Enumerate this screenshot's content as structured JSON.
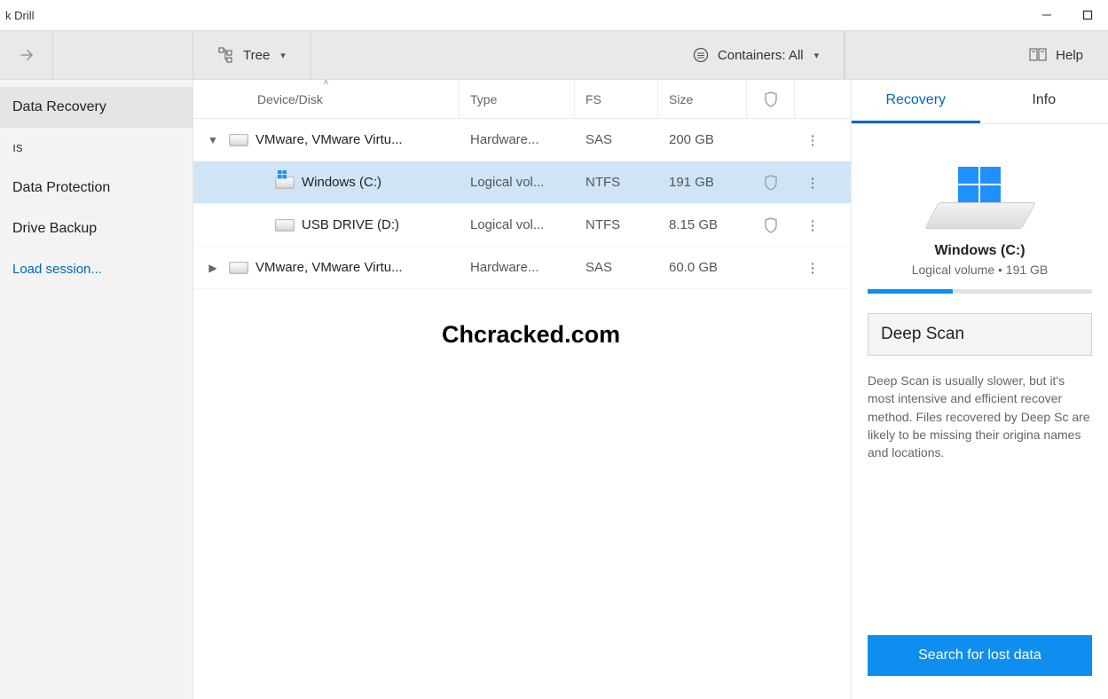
{
  "window": {
    "title": "k Drill"
  },
  "toolbar": {
    "tree_label": "Tree",
    "containers_label": "Containers: All",
    "help_label": "Help"
  },
  "sidebar": {
    "items": [
      {
        "label": "Data Recovery"
      },
      {
        "label": "ıs"
      },
      {
        "label": "Data Protection"
      },
      {
        "label": "Drive Backup"
      }
    ],
    "link": "Load session..."
  },
  "columns": {
    "device": "Device/Disk",
    "type": "Type",
    "fs": "FS",
    "size": "Size"
  },
  "rows": [
    {
      "expand": "down",
      "indent": 0,
      "name": "VMware, VMware Virtu...",
      "type": "Hardware...",
      "fs": "SAS",
      "size": "200 GB",
      "shield": false,
      "selected": false,
      "icon": "disk"
    },
    {
      "expand": "",
      "indent": 1,
      "name": "Windows (C:)",
      "type": "Logical vol...",
      "fs": "NTFS",
      "size": "191 GB",
      "shield": true,
      "selected": true,
      "icon": "win"
    },
    {
      "expand": "",
      "indent": 1,
      "name": "USB DRIVE (D:)",
      "type": "Logical vol...",
      "fs": "NTFS",
      "size": "8.15 GB",
      "shield": true,
      "selected": false,
      "icon": "disk"
    },
    {
      "expand": "right",
      "indent": 0,
      "name": "VMware, VMware Virtu...",
      "type": "Hardware...",
      "fs": "SAS",
      "size": "60.0 GB",
      "shield": false,
      "selected": false,
      "icon": "disk"
    }
  ],
  "watermark": "Chcracked.com",
  "right": {
    "tabs": {
      "recovery": "Recovery",
      "info": "Info"
    },
    "drive_title": "Windows (C:)",
    "drive_sub": "Logical volume • 191 GB",
    "scan_label": "Deep Scan",
    "scan_desc": "Deep Scan is usually slower, but it's most intensive and efficient recover method. Files recovered by Deep Sc are likely to be missing their origina names and locations.",
    "search_btn": "Search for lost data"
  }
}
